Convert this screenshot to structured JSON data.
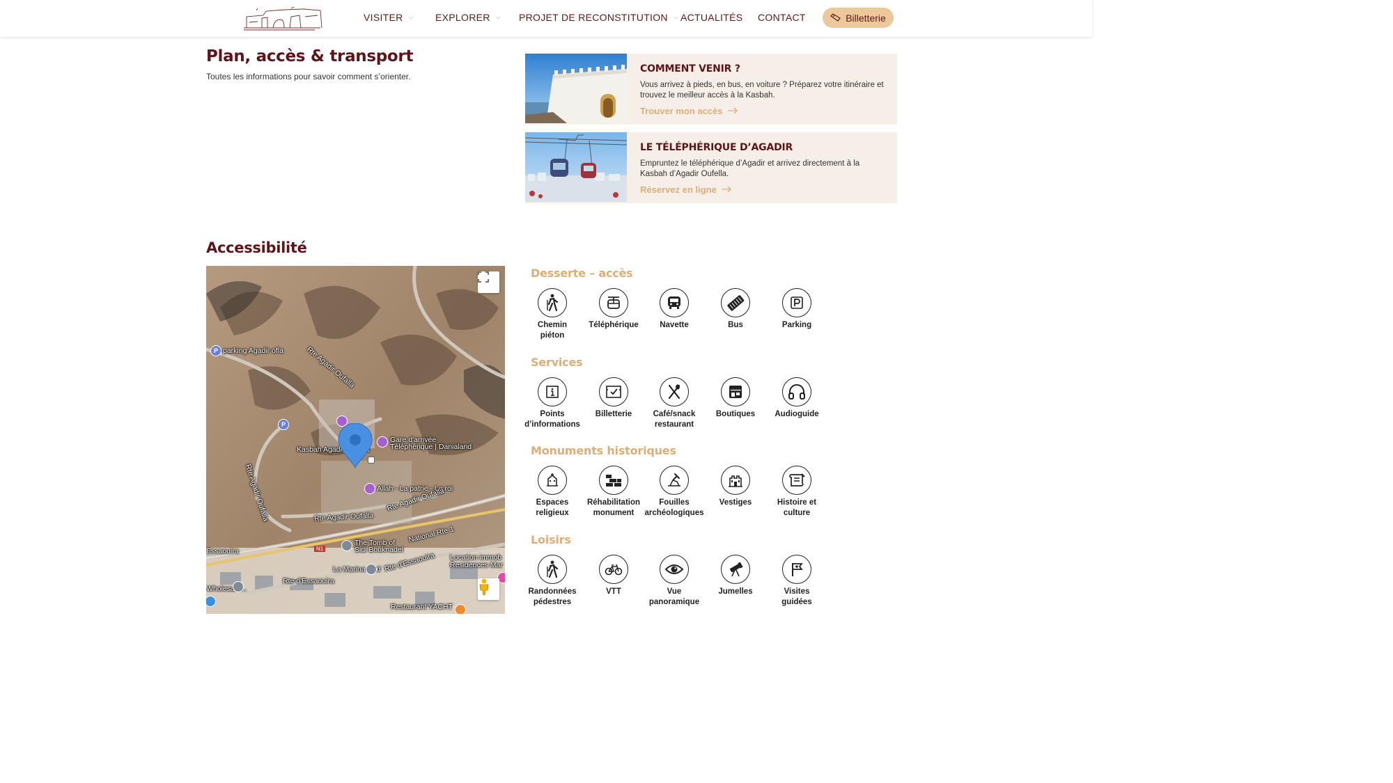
{
  "header": {
    "nav": [
      {
        "label": "VISITER",
        "chevron": true
      },
      {
        "label": "EXPLORER",
        "chevron": true
      },
      {
        "label": "PROJET DE RECONSTITUTION",
        "chevron": true
      },
      {
        "label": "ACTUALITÉS",
        "chevron": false
      },
      {
        "label": "CONTACT",
        "chevron": false
      }
    ],
    "billetterie": "Billetterie"
  },
  "plan": {
    "title": "Plan, accès & transport",
    "subtitle": "Toutes les informations pour savoir comment s’orienter."
  },
  "cards": [
    {
      "title": "COMMENT VENIR ?",
      "desc": "Vous arrivez à pieds, en bus, en voiture ? Préparez votre itinéraire et trouvez le meilleur accès à la Kasbah.",
      "link": "Trouver mon accès"
    },
    {
      "title": "LE TÉLÉPHÉRIQUE D’AGADIR",
      "desc": "Empruntez le téléphérique d’Agadir et arrivez directement à la Kasbah d’Agadir Oufella.",
      "link": "Réservez en ligne"
    }
  ],
  "accessibility": {
    "title": "Accessibilité"
  },
  "map": {
    "labels": {
      "parking": "parking Agadir ofla",
      "road1": "Rte Agadir Oufalla",
      "kasbah": "Kasbah Agadir Oufella",
      "gare1": "Gare d'arrivée",
      "gare2": "Téléphérique | Danialand",
      "allah": "Allah - La patrie - Le roi",
      "road2": "Rte Agadir Oufalla",
      "road3": "Rte Agadir Oufalla",
      "road4": "Rte Agadir Oufalla",
      "tomb1": "The Tomb of",
      "tomb2": "Sidi Bouknadel",
      "national": "National Rte 1",
      "essaouira1": "Essaouira",
      "essaouira2": "Rte d'Essaouira",
      "essaouira3": "Rte d'Essaouira",
      "marina": "La Marina Sud",
      "location1": "Location immob",
      "location2": "Residences Mar",
      "wholesale": "Wholesale...",
      "restaurant": "Restaurant YACHT",
      "n1": "N1"
    }
  },
  "sections": [
    {
      "title": "Desserte – accès",
      "items": [
        {
          "label": "Chemin\npiéton",
          "icon": "hiker-icon"
        },
        {
          "label": "Téléphérique",
          "icon": "cable-car-icon"
        },
        {
          "label": "Navette",
          "icon": "shuttle-icon"
        },
        {
          "label": "Bus",
          "icon": "bus-ticket-icon"
        },
        {
          "label": "Parking",
          "icon": "parking-icon"
        }
      ]
    },
    {
      "title": "Services",
      "items": [
        {
          "label": "Points\nd’informations",
          "icon": "info-icon"
        },
        {
          "label": "Billetterie",
          "icon": "ticket-check-icon"
        },
        {
          "label": "Café/snack\nrestaurant",
          "icon": "cutlery-icon"
        },
        {
          "label": "Boutiques",
          "icon": "shop-icon"
        },
        {
          "label": "Audioguide",
          "icon": "headphones-icon"
        }
      ]
    },
    {
      "title": "Monuments historiques",
      "items": [
        {
          "label": "Espaces\nreligieux",
          "icon": "religious-icon"
        },
        {
          "label": "Réhabilitation\nmonument",
          "icon": "bricks-icon"
        },
        {
          "label": "Fouilles\narchéologiques",
          "icon": "excavation-icon"
        },
        {
          "label": "Vestiges",
          "icon": "ruins-icon"
        },
        {
          "label": "Histoire et\nculture",
          "icon": "scroll-icon"
        }
      ]
    },
    {
      "title": "Loisirs",
      "items": [
        {
          "label": "Randonnées\npédestres",
          "icon": "hiking-icon"
        },
        {
          "label": "VTT",
          "icon": "bike-icon"
        },
        {
          "label": "Vue\npanoramique",
          "icon": "eye-icon"
        },
        {
          "label": "Jumelles",
          "icon": "telescope-icon"
        },
        {
          "label": "Visites\nguidées",
          "icon": "flag-icon"
        }
      ]
    }
  ],
  "colors": {
    "brand": "#5e1418",
    "accent": "#dcae78",
    "card_bg": "#f5efe8",
    "billet_bg": "#ecc89a"
  }
}
